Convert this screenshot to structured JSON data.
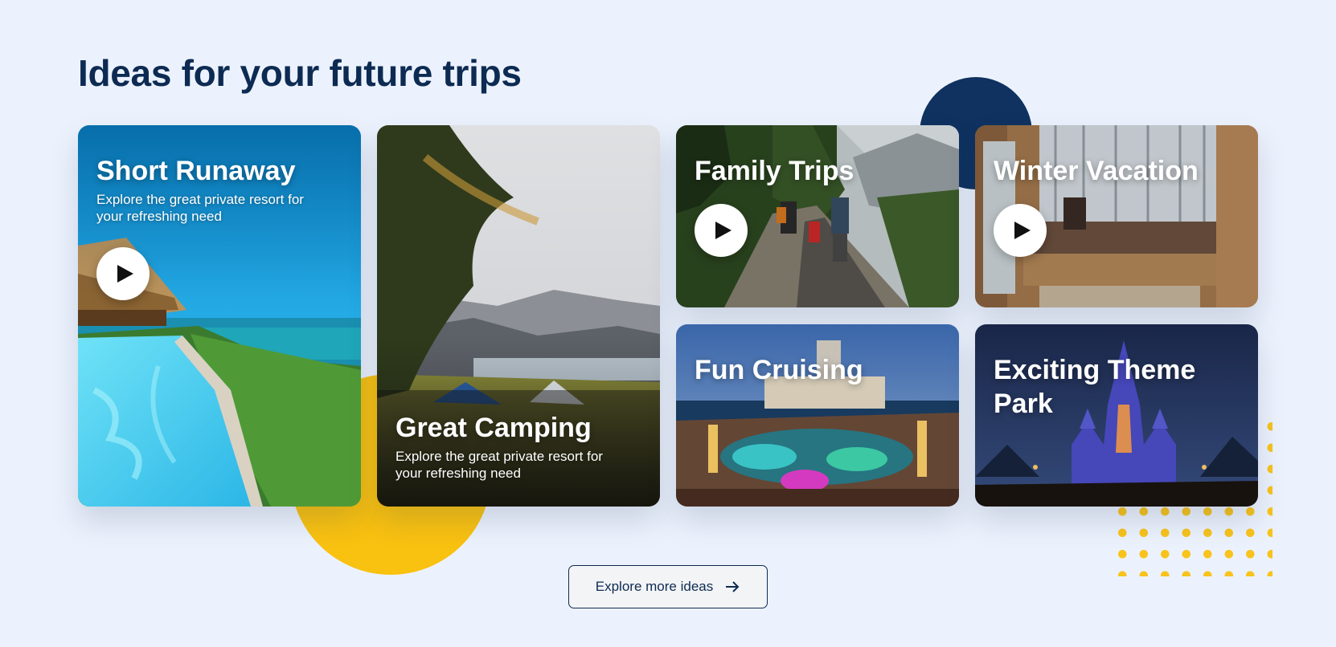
{
  "section": {
    "title": "Ideas for your future trips"
  },
  "cards": [
    {
      "title": "Short Runaway",
      "description": "Explore the great private resort for your refreshing need",
      "has_play": true
    },
    {
      "title": "Great Camping",
      "description": "Explore the great private resort for your refreshing need",
      "has_play": false
    },
    {
      "title": "Family Trips",
      "has_play": true
    },
    {
      "title": "Winter Vacation",
      "has_play": true
    },
    {
      "title": "Fun Cruising",
      "has_play": false
    },
    {
      "title": "Exciting Theme Park",
      "has_play": false
    }
  ],
  "explore_button": {
    "label": "Explore more ideas",
    "icon": "arrow-right-icon"
  },
  "colors": {
    "background": "#ecf2fd",
    "heading": "#0d2b52",
    "accent_yellow": "#f9c110",
    "accent_navy": "#0f3260"
  }
}
